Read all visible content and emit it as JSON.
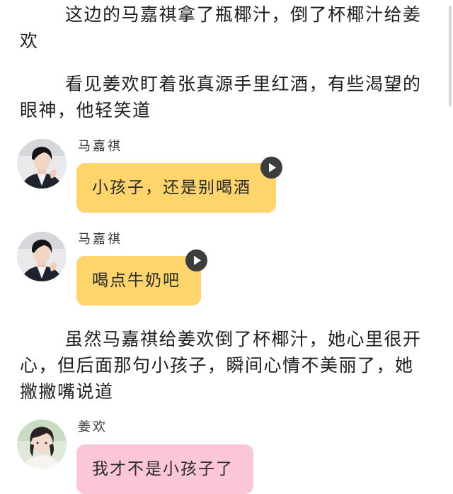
{
  "story": {
    "paragraphs": [
      "这边的马嘉祺拿了瓶椰汁，倒了杯椰汁给姜欢",
      "看见姜欢盯着张真源手里红酒，有些渴望的眼神，他轻笑道",
      "虽然马嘉祺给姜欢倒了杯椰汁，她心里很开心，但后面那句小孩子，瞬间心情不美丽了，她撇撇嘴说道"
    ]
  },
  "messages": [
    {
      "sender": "马嘉祺",
      "text": "小孩子，还是别喝酒",
      "bubble_color": "#fdd56b",
      "avatar_icon": "boy-portrait-avatar",
      "has_voice_button": true
    },
    {
      "sender": "马嘉祺",
      "text": "喝点牛奶吧",
      "bubble_color": "#fdd56b",
      "avatar_icon": "boy-portrait-avatar",
      "has_voice_button": true
    },
    {
      "sender": "姜欢",
      "text": "我才不是小孩子了",
      "bubble_color": "#fbc7d7",
      "avatar_icon": "girl-portrait-avatar",
      "has_voice_button": false
    }
  ],
  "icons": {
    "play": "play-icon"
  }
}
